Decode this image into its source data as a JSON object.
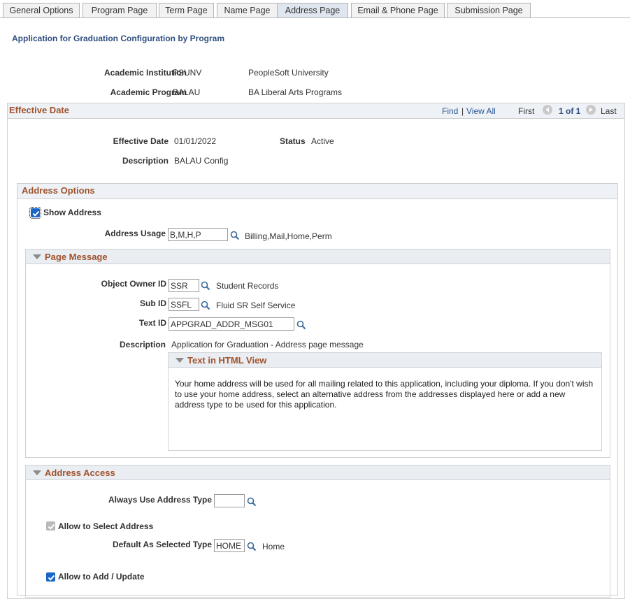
{
  "tabs": [
    {
      "label": "General Options"
    },
    {
      "label": "Program Page"
    },
    {
      "label": "Term Page"
    },
    {
      "label": "Name Page"
    },
    {
      "label": "Address Page"
    },
    {
      "label": "Email & Phone Page"
    },
    {
      "label": "Submission Page"
    }
  ],
  "page_title": "Application for Graduation Configuration by Program",
  "header": {
    "institution_label": "Academic Institution",
    "institution_code": "PSUNV",
    "institution_desc": "PeopleSoft University",
    "program_label": "Academic Program",
    "program_code": "BALAU",
    "program_desc": "BA Liberal Arts Programs"
  },
  "effective_date_group": {
    "title": "Effective Date",
    "find": "Find",
    "separator": "|",
    "view_all": "View All",
    "first": "First",
    "counter": "1 of 1",
    "last": "Last",
    "effdt_label": "Effective Date",
    "effdt_value": "01/01/2022",
    "status_label": "Status",
    "status_value": "Active",
    "descr_label": "Description",
    "descr_value": "BALAU Config"
  },
  "address_options": {
    "title": "Address Options",
    "show_address_label": "Show Address",
    "show_address_checked": true,
    "address_usage_label": "Address Usage",
    "address_usage_value": "B,M,H,P",
    "address_usage_desc": "Billing,Mail,Home,Perm"
  },
  "page_message": {
    "title": "Page Message",
    "object_owner_label": "Object Owner ID",
    "object_owner_value": "SSR",
    "object_owner_desc": "Student Records",
    "sub_id_label": "Sub ID",
    "sub_id_value": "SSFL",
    "sub_id_desc": "Fluid SR Self Service",
    "text_id_label": "Text ID",
    "text_id_value": "APPGRAD_ADDR_MSG01",
    "description_label": "Description",
    "description_value": "Application for Graduation - Address page message",
    "html_view_title": "Text in HTML View",
    "html_text": "Your home address will be used for all mailing related to this application, including your diploma. If you don't wish to use your home address, select an alternative address from the addresses displayed here or add a new address type to be used for this application."
  },
  "address_access": {
    "title": "Address Access",
    "always_use_label": "Always Use Address Type",
    "always_use_value": "",
    "allow_select_label": "Allow to Select Address",
    "allow_select_checked": true,
    "default_selected_label": "Default As Selected Type",
    "default_selected_value": "HOME",
    "default_selected_desc": "Home",
    "allow_add_label": "Allow to Add / Update",
    "allow_add_checked": true
  },
  "icons": {
    "lookup": "magnifier-icon",
    "collapse": "collapse-triangle-icon",
    "prev": "previous-arrow-icon",
    "next": "next-arrow-icon",
    "checkbox": "checkmark-icon"
  },
  "colors": {
    "section_title": "#a0522d",
    "page_title": "#2f4f7f",
    "link": "#2b5797",
    "checkbox": "#1a66c6",
    "tab_active": "#dfe6ef"
  }
}
